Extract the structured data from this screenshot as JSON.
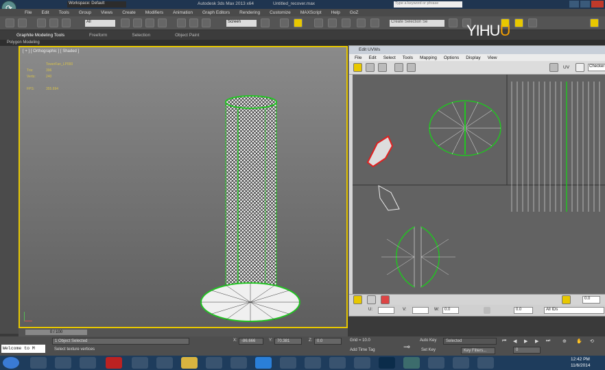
{
  "window": {
    "title": "Autodesk 3ds Max 2013 x64",
    "file": "Untitled_recover.max",
    "workspace": "Workspace: Default",
    "search_placeholder": "Type a keyword or phrase"
  },
  "menu": [
    "File",
    "Edit",
    "Tools",
    "Group",
    "Views",
    "Create",
    "Modifiers",
    "Animation",
    "Graph Editors",
    "Rendering",
    "Customize",
    "MAXScript",
    "Help",
    "GoZ"
  ],
  "toolbar": {
    "filter": "All",
    "view": "Screen",
    "selection_set": "Create Selection Se"
  },
  "ribbon": {
    "tabs": [
      "Graphite Modeling Tools",
      "Freeform",
      "Selection",
      "Object Paint"
    ],
    "sub": "Polygon Modeling"
  },
  "viewport": {
    "label": "[ + ] [ Orthographic ] [ Shaded ]",
    "object": "TowerFan_LP000",
    "tris_label": "Tris:",
    "tris": "396",
    "verts_label": "Verts:",
    "verts": "240",
    "fps_label": "FPS:",
    "fps": "355.694"
  },
  "uv": {
    "title": "Edit UVWs",
    "menu": [
      "File",
      "Edit",
      "Select",
      "Tools",
      "Mapping",
      "Options",
      "Display",
      "View"
    ],
    "uv_label": "UV",
    "checker": "Checker",
    "u_label": "U:",
    "v_label": "V:",
    "w_label": "W:",
    "w_value": "0.0",
    "spin_value": "0.0",
    "all_ids": "All IDs",
    "zero": "0.0"
  },
  "timeline": {
    "frame": "0 / 100"
  },
  "status": {
    "selected": "1 Object Selected",
    "prompt": "Select texture vertices",
    "x_label": "X:",
    "x": "-86.666",
    "y_label": "Y:",
    "y": "70.381",
    "z_label": "Z:",
    "z": "0.0",
    "grid": "Grid = 10.0",
    "add_time_tag": "Add Time Tag",
    "auto_key": "Auto Key",
    "set_key": "Set Key",
    "selected_drop": "Selected",
    "key_filters": "Key Filters...",
    "frame_field": "0",
    "maxscript": "Welcome to M"
  },
  "tray": {
    "time": "12:42 PM",
    "date": "11/6/2014"
  },
  "watermark": {
    "pre": "YIHU",
    "accent": "U",
    ".com": ".COM"
  }
}
